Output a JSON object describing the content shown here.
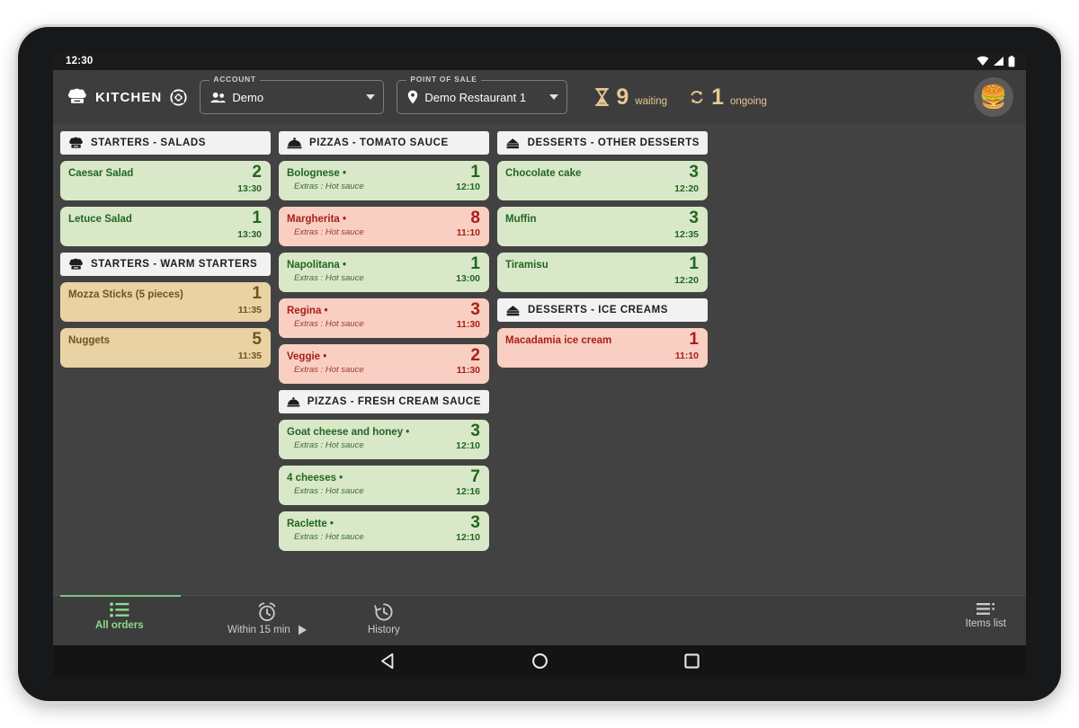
{
  "status_bar": {
    "clock": "12:30",
    "icons": [
      "wifi-icon",
      "signal-icon",
      "battery-icon"
    ]
  },
  "header": {
    "brand_title": "KITCHEN",
    "brand_icon": "chef-hat-icon",
    "settings_icon": "target-settings-icon",
    "account": {
      "legend": "ACCOUNT",
      "value": "Demo",
      "icon": "people-icon"
    },
    "point_of_sale": {
      "legend": "POINT OF SALE",
      "value": "Demo Restaurant 1",
      "icon": "location-pin-icon"
    },
    "counters": [
      {
        "icon": "hourglass-icon",
        "number": "9",
        "label": "waiting"
      },
      {
        "icon": "sync-icon",
        "number": "1",
        "label": "ongoing"
      }
    ],
    "avatar": {
      "icon": "burger-avatar-icon",
      "glyph": "🍔"
    },
    "accent_color": "#e7c893"
  },
  "board": {
    "columns": [
      {
        "sections": [
          {
            "icon": "chef-hat-icon",
            "title": "STARTERS - SALADS",
            "orders": [
              {
                "name": "Caesar Salad",
                "extras": "",
                "qty": "2",
                "time": "13:30",
                "status": "green"
              },
              {
                "name": "Letuce Salad",
                "extras": "",
                "qty": "1",
                "time": "13:30",
                "status": "green"
              }
            ]
          },
          {
            "icon": "chef-hat-icon",
            "title": "STARTERS - WARM STARTERS",
            "orders": [
              {
                "name": "Mozza Sticks (5 pieces)",
                "extras": "",
                "qty": "1",
                "time": "11:35",
                "status": "tan"
              },
              {
                "name": "Nuggets",
                "extras": "",
                "qty": "5",
                "time": "11:35",
                "status": "tan"
              }
            ]
          }
        ]
      },
      {
        "sections": [
          {
            "icon": "cloche-icon",
            "title": "PIZZAS - TOMATO SAUCE",
            "orders": [
              {
                "name": "Bolognese •",
                "extras": "Extras : Hot sauce",
                "qty": "1",
                "time": "12:10",
                "status": "green"
              },
              {
                "name": "Margherita •",
                "extras": "Extras : Hot sauce",
                "qty": "8",
                "time": "11:10",
                "status": "red"
              },
              {
                "name": "Napolitana •",
                "extras": "Extras : Hot sauce",
                "qty": "1",
                "time": "13:00",
                "status": "green"
              },
              {
                "name": "Regina •",
                "extras": "Extras : Hot sauce",
                "qty": "3",
                "time": "11:30",
                "status": "red"
              },
              {
                "name": "Veggie •",
                "extras": "Extras : Hot sauce",
                "qty": "2",
                "time": "11:30",
                "status": "red"
              }
            ]
          },
          {
            "icon": "cloche-icon",
            "title": "PIZZAS - FRESH CREAM SAUCE",
            "orders": [
              {
                "name": "Goat cheese and honey •",
                "extras": "Extras : Hot sauce",
                "qty": "3",
                "time": "12:10",
                "status": "green"
              },
              {
                "name": "4 cheeses •",
                "extras": "Extras : Hot sauce",
                "qty": "7",
                "time": "12:16",
                "status": "green"
              },
              {
                "name": "Raclette •",
                "extras": "Extras : Hot sauce",
                "qty": "3",
                "time": "12:10",
                "status": "green"
              }
            ]
          }
        ]
      },
      {
        "sections": [
          {
            "icon": "cake-slice-icon",
            "title": "DESSERTS - OTHER DESSERTS",
            "orders": [
              {
                "name": "Chocolate cake",
                "extras": "",
                "qty": "3",
                "time": "12:20",
                "status": "green"
              },
              {
                "name": "Muffin",
                "extras": "",
                "qty": "3",
                "time": "12:35",
                "status": "green"
              },
              {
                "name": "Tiramisu",
                "extras": "",
                "qty": "1",
                "time": "12:20",
                "status": "green"
              }
            ]
          },
          {
            "icon": "cake-slice-icon",
            "title": "DESSERTS - ICE CREAMS",
            "orders": [
              {
                "name": "Macadamia ice cream",
                "extras": "",
                "qty": "1",
                "time": "11:10",
                "status": "red"
              }
            ]
          }
        ]
      }
    ]
  },
  "bottom_nav": {
    "all_orders": {
      "label": "All orders",
      "icon": "list-icon",
      "active": true
    },
    "within_15": {
      "label": "Within 15 min",
      "icon": "alarm-clock-icon",
      "play_icon": "play-triangle-icon"
    },
    "history": {
      "label": "History",
      "icon": "history-clock-icon"
    },
    "items_list": {
      "label": "Items list",
      "icon": "items-list-icon"
    },
    "active_color": "#8fd88f"
  },
  "android_nav": {
    "back": "back-triangle-icon",
    "home": "home-circle-icon",
    "recents": "recents-square-icon"
  }
}
